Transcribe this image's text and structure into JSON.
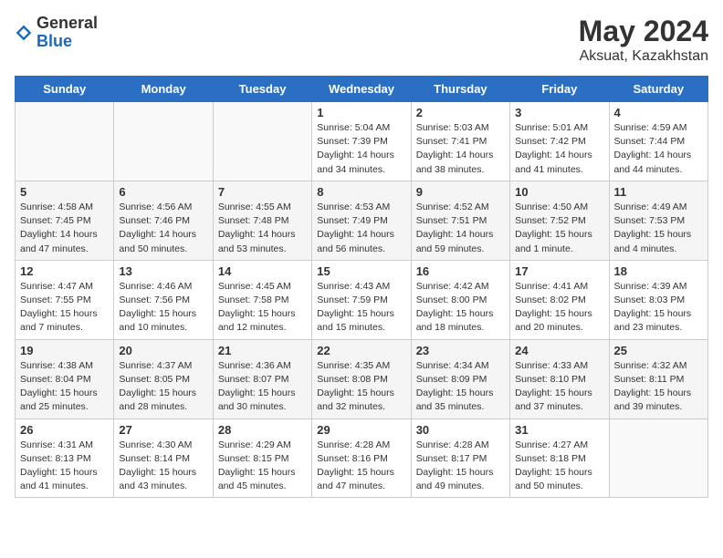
{
  "logo": {
    "general": "General",
    "blue": "Blue"
  },
  "title": "May 2024",
  "location": "Aksuat, Kazakhstan",
  "headers": [
    "Sunday",
    "Monday",
    "Tuesday",
    "Wednesday",
    "Thursday",
    "Friday",
    "Saturday"
  ],
  "weeks": [
    [
      {
        "day": "",
        "info": ""
      },
      {
        "day": "",
        "info": ""
      },
      {
        "day": "",
        "info": ""
      },
      {
        "day": "1",
        "info": "Sunrise: 5:04 AM\nSunset: 7:39 PM\nDaylight: 14 hours\nand 34 minutes."
      },
      {
        "day": "2",
        "info": "Sunrise: 5:03 AM\nSunset: 7:41 PM\nDaylight: 14 hours\nand 38 minutes."
      },
      {
        "day": "3",
        "info": "Sunrise: 5:01 AM\nSunset: 7:42 PM\nDaylight: 14 hours\nand 41 minutes."
      },
      {
        "day": "4",
        "info": "Sunrise: 4:59 AM\nSunset: 7:44 PM\nDaylight: 14 hours\nand 44 minutes."
      }
    ],
    [
      {
        "day": "5",
        "info": "Sunrise: 4:58 AM\nSunset: 7:45 PM\nDaylight: 14 hours\nand 47 minutes."
      },
      {
        "day": "6",
        "info": "Sunrise: 4:56 AM\nSunset: 7:46 PM\nDaylight: 14 hours\nand 50 minutes."
      },
      {
        "day": "7",
        "info": "Sunrise: 4:55 AM\nSunset: 7:48 PM\nDaylight: 14 hours\nand 53 minutes."
      },
      {
        "day": "8",
        "info": "Sunrise: 4:53 AM\nSunset: 7:49 PM\nDaylight: 14 hours\nand 56 minutes."
      },
      {
        "day": "9",
        "info": "Sunrise: 4:52 AM\nSunset: 7:51 PM\nDaylight: 14 hours\nand 59 minutes."
      },
      {
        "day": "10",
        "info": "Sunrise: 4:50 AM\nSunset: 7:52 PM\nDaylight: 15 hours\nand 1 minute."
      },
      {
        "day": "11",
        "info": "Sunrise: 4:49 AM\nSunset: 7:53 PM\nDaylight: 15 hours\nand 4 minutes."
      }
    ],
    [
      {
        "day": "12",
        "info": "Sunrise: 4:47 AM\nSunset: 7:55 PM\nDaylight: 15 hours\nand 7 minutes."
      },
      {
        "day": "13",
        "info": "Sunrise: 4:46 AM\nSunset: 7:56 PM\nDaylight: 15 hours\nand 10 minutes."
      },
      {
        "day": "14",
        "info": "Sunrise: 4:45 AM\nSunset: 7:58 PM\nDaylight: 15 hours\nand 12 minutes."
      },
      {
        "day": "15",
        "info": "Sunrise: 4:43 AM\nSunset: 7:59 PM\nDaylight: 15 hours\nand 15 minutes."
      },
      {
        "day": "16",
        "info": "Sunrise: 4:42 AM\nSunset: 8:00 PM\nDaylight: 15 hours\nand 18 minutes."
      },
      {
        "day": "17",
        "info": "Sunrise: 4:41 AM\nSunset: 8:02 PM\nDaylight: 15 hours\nand 20 minutes."
      },
      {
        "day": "18",
        "info": "Sunrise: 4:39 AM\nSunset: 8:03 PM\nDaylight: 15 hours\nand 23 minutes."
      }
    ],
    [
      {
        "day": "19",
        "info": "Sunrise: 4:38 AM\nSunset: 8:04 PM\nDaylight: 15 hours\nand 25 minutes."
      },
      {
        "day": "20",
        "info": "Sunrise: 4:37 AM\nSunset: 8:05 PM\nDaylight: 15 hours\nand 28 minutes."
      },
      {
        "day": "21",
        "info": "Sunrise: 4:36 AM\nSunset: 8:07 PM\nDaylight: 15 hours\nand 30 minutes."
      },
      {
        "day": "22",
        "info": "Sunrise: 4:35 AM\nSunset: 8:08 PM\nDaylight: 15 hours\nand 32 minutes."
      },
      {
        "day": "23",
        "info": "Sunrise: 4:34 AM\nSunset: 8:09 PM\nDaylight: 15 hours\nand 35 minutes."
      },
      {
        "day": "24",
        "info": "Sunrise: 4:33 AM\nSunset: 8:10 PM\nDaylight: 15 hours\nand 37 minutes."
      },
      {
        "day": "25",
        "info": "Sunrise: 4:32 AM\nSunset: 8:11 PM\nDaylight: 15 hours\nand 39 minutes."
      }
    ],
    [
      {
        "day": "26",
        "info": "Sunrise: 4:31 AM\nSunset: 8:13 PM\nDaylight: 15 hours\nand 41 minutes."
      },
      {
        "day": "27",
        "info": "Sunrise: 4:30 AM\nSunset: 8:14 PM\nDaylight: 15 hours\nand 43 minutes."
      },
      {
        "day": "28",
        "info": "Sunrise: 4:29 AM\nSunset: 8:15 PM\nDaylight: 15 hours\nand 45 minutes."
      },
      {
        "day": "29",
        "info": "Sunrise: 4:28 AM\nSunset: 8:16 PM\nDaylight: 15 hours\nand 47 minutes."
      },
      {
        "day": "30",
        "info": "Sunrise: 4:28 AM\nSunset: 8:17 PM\nDaylight: 15 hours\nand 49 minutes."
      },
      {
        "day": "31",
        "info": "Sunrise: 4:27 AM\nSunset: 8:18 PM\nDaylight: 15 hours\nand 50 minutes."
      },
      {
        "day": "",
        "info": ""
      }
    ]
  ]
}
